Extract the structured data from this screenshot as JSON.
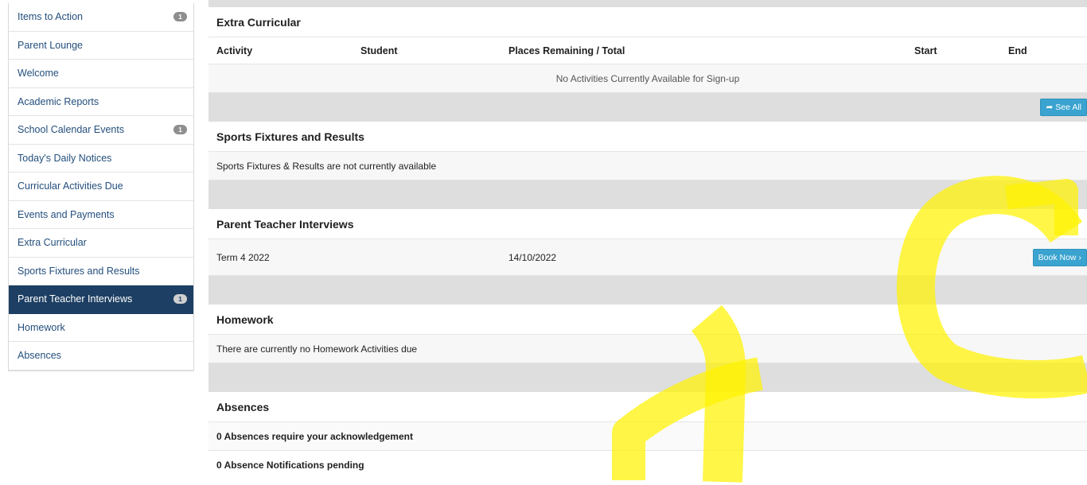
{
  "sidebar": {
    "items": [
      {
        "label": "Items to Action",
        "badge": "1"
      },
      {
        "label": "Parent Lounge",
        "badge": ""
      },
      {
        "label": "Welcome",
        "badge": ""
      },
      {
        "label": "Academic Reports",
        "badge": ""
      },
      {
        "label": "School Calendar Events",
        "badge": "1"
      },
      {
        "label": "Today's Daily Notices",
        "badge": ""
      },
      {
        "label": "Curricular Activities Due",
        "badge": ""
      },
      {
        "label": "Events and Payments",
        "badge": ""
      },
      {
        "label": "Extra Curricular",
        "badge": ""
      },
      {
        "label": "Sports Fixtures and Results",
        "badge": ""
      },
      {
        "label": "Parent Teacher Interviews",
        "badge": "1"
      },
      {
        "label": "Homework",
        "badge": ""
      },
      {
        "label": "Absences",
        "badge": ""
      }
    ]
  },
  "extra": {
    "title": "Extra Curricular",
    "columns": {
      "activity": "Activity",
      "student": "Student",
      "places": "Places Remaining / Total",
      "start": "Start",
      "end": "End"
    },
    "empty_message": "No Activities Currently Available for Sign-up",
    "see_all_label": "See All"
  },
  "sports": {
    "title": "Sports Fixtures and Results",
    "message": "Sports Fixtures & Results are not currently available"
  },
  "interviews": {
    "title": "Parent Teacher Interviews",
    "term": "Term 4 2022",
    "date": "14/10/2022",
    "book_label": "Book Now"
  },
  "homework": {
    "title": "Homework",
    "message": "There are currently no Homework Activities due"
  },
  "absences": {
    "title": "Absences",
    "ack_message": "0 Absences require your acknowledgement",
    "pending_message": "0 Absence Notifications pending"
  },
  "colors": {
    "sidebar_active": "#1d3f63",
    "link": "#244f7d",
    "button": "#3aa3cf",
    "highlighter": "#fff200"
  }
}
